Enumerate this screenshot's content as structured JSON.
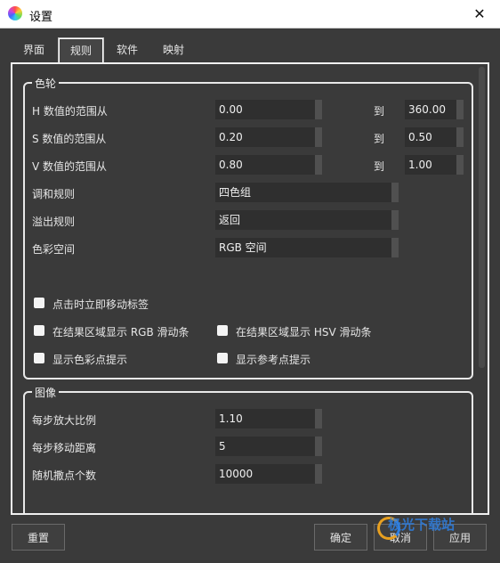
{
  "window": {
    "title": "设置",
    "close": "✕"
  },
  "tabs": [
    "界面",
    "规则",
    "软件",
    "映射"
  ],
  "color_wheel": {
    "title": "色轮",
    "ranges": [
      {
        "label": "H 数值的范围从",
        "from": "0.00",
        "to_label": "到",
        "to": "360.00"
      },
      {
        "label": "S 数值的范围从",
        "from": "0.20",
        "to_label": "到",
        "to": "0.50"
      },
      {
        "label": "V 数值的范围从",
        "from": "0.80",
        "to_label": "到",
        "to": "1.00"
      }
    ],
    "selects": [
      {
        "label": "调和规则",
        "value": "四色组"
      },
      {
        "label": "溢出规则",
        "value": "返回"
      },
      {
        "label": "色彩空间",
        "value": "RGB 空间"
      }
    ],
    "checkboxes": [
      "点击时立即移动标签",
      "在结果区域显示 RGB 滑动条",
      "在结果区域显示 HSV 滑动条",
      "显示色彩点提示",
      "显示参考点提示"
    ]
  },
  "image": {
    "title": "图像",
    "fields": [
      {
        "label": "每步放大比例",
        "value": "1.10"
      },
      {
        "label": "每步移动距离",
        "value": "5"
      },
      {
        "label": "随机撒点个数",
        "value": "10000"
      }
    ]
  },
  "buttons": {
    "reset": "重置",
    "ok": "确定",
    "cancel": "取消",
    "apply": "应用"
  },
  "watermark": "极光下载站"
}
